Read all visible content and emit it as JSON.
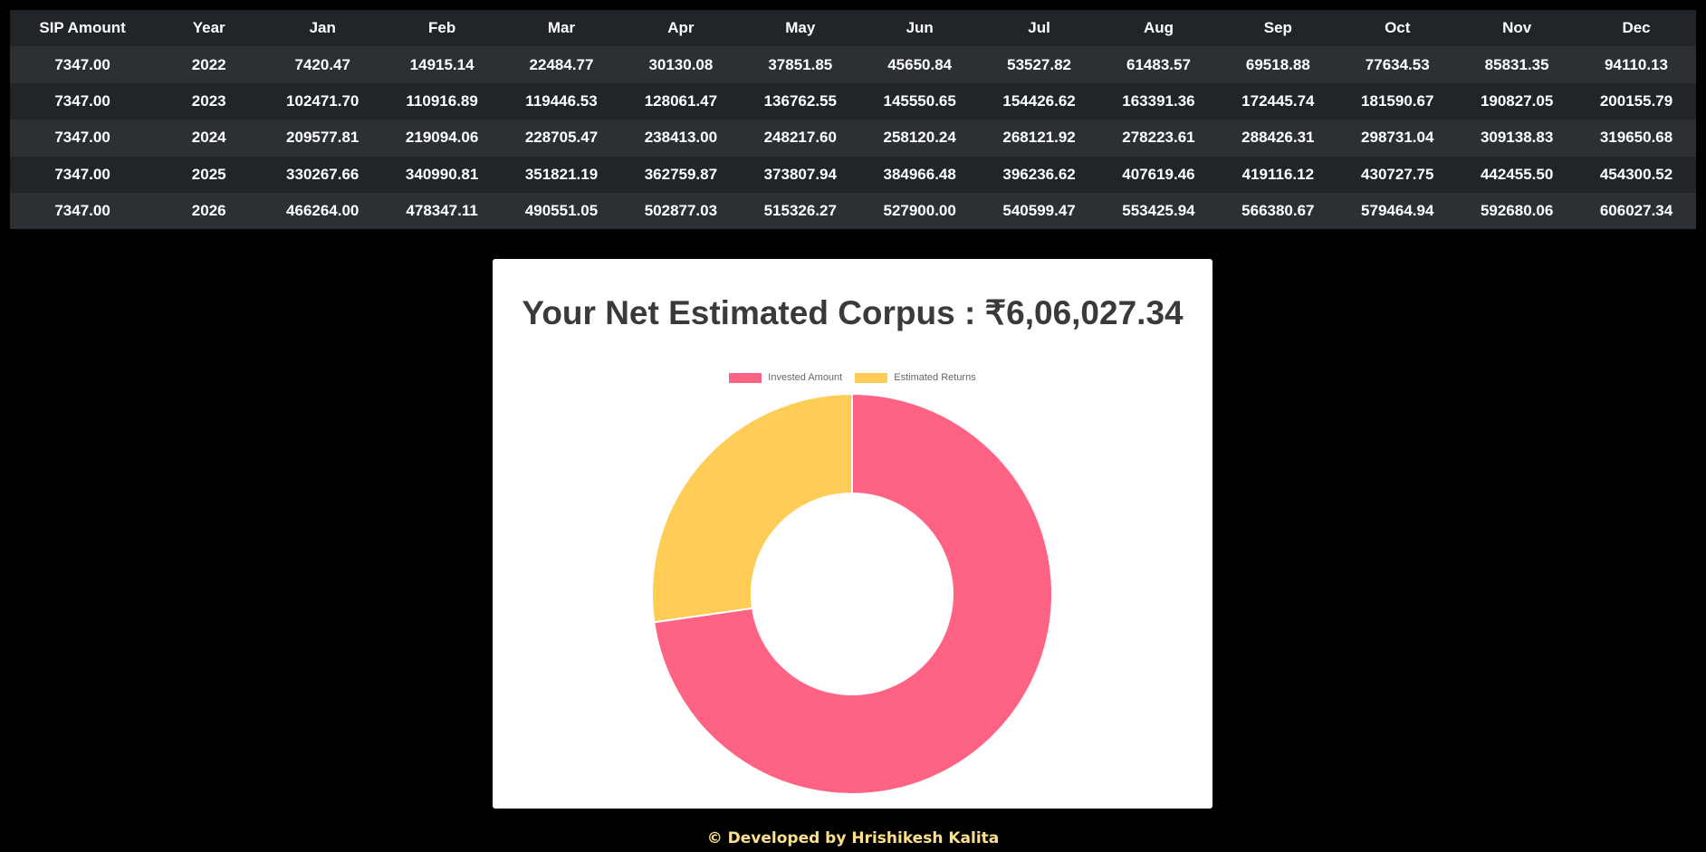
{
  "table": {
    "headers": [
      "SIP Amount",
      "Year",
      "Jan",
      "Feb",
      "Mar",
      "Apr",
      "May",
      "Jun",
      "Jul",
      "Aug",
      "Sep",
      "Oct",
      "Nov",
      "Dec"
    ],
    "rows": [
      [
        "7347.00",
        "2022",
        "7420.47",
        "14915.14",
        "22484.77",
        "30130.08",
        "37851.85",
        "45650.84",
        "53527.82",
        "61483.57",
        "69518.88",
        "77634.53",
        "85831.35",
        "94110.13"
      ],
      [
        "7347.00",
        "2023",
        "102471.70",
        "110916.89",
        "119446.53",
        "128061.47",
        "136762.55",
        "145550.65",
        "154426.62",
        "163391.36",
        "172445.74",
        "181590.67",
        "190827.05",
        "200155.79"
      ],
      [
        "7347.00",
        "2024",
        "209577.81",
        "219094.06",
        "228705.47",
        "238413.00",
        "248217.60",
        "258120.24",
        "268121.92",
        "278223.61",
        "288426.31",
        "298731.04",
        "309138.83",
        "319650.68"
      ],
      [
        "7347.00",
        "2025",
        "330267.66",
        "340990.81",
        "351821.19",
        "362759.87",
        "373807.94",
        "384966.48",
        "396236.62",
        "407619.46",
        "419116.12",
        "430727.75",
        "442455.50",
        "454300.52"
      ],
      [
        "7347.00",
        "2026",
        "466264.00",
        "478347.11",
        "490551.05",
        "502877.03",
        "515326.27",
        "527900.00",
        "540599.47",
        "553425.94",
        "566380.67",
        "579464.94",
        "592680.06",
        "606027.34"
      ]
    ]
  },
  "result": {
    "title": "Your Net Estimated Corpus : ₹6,06,027.34"
  },
  "chart_data": {
    "type": "pie",
    "categories": [
      "Invested Amount",
      "Estimated Returns"
    ],
    "values": [
      440820,
      165207.34
    ],
    "colors": [
      "#ff6384",
      "#ffcd56"
    ],
    "legend_position": "top",
    "doughnut": true
  },
  "footer": {
    "text": "© Developed by Hrishikesh Kalita"
  }
}
